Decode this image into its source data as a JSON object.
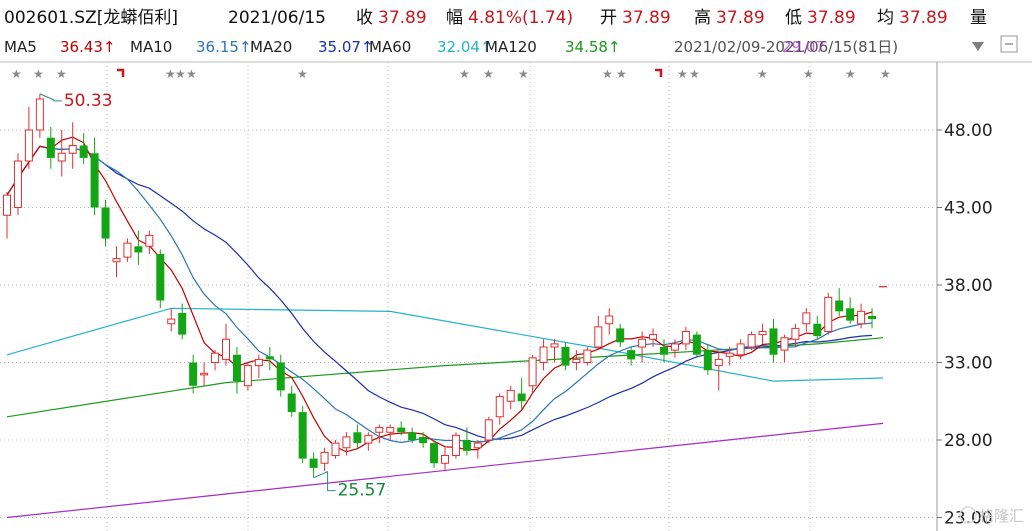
{
  "header": {
    "code_name": "002601.SZ[龙蟒佰利]",
    "date": "2021/06/15",
    "items": [
      {
        "label": "收",
        "value": "37.89"
      },
      {
        "label": "幅",
        "value": "4.81%(1.74)"
      },
      {
        "label": "开",
        "value": "37.89"
      },
      {
        "label": "高",
        "value": "37.89"
      },
      {
        "label": "低",
        "value": "37.89"
      },
      {
        "label": "均",
        "value": "37.89"
      },
      {
        "label": "量",
        "value": ""
      }
    ]
  },
  "ma_bar": {
    "items": [
      {
        "label": "MA5",
        "value": "36.43↑",
        "color": "#c00000"
      },
      {
        "label": "MA10",
        "value": "36.15↑",
        "color": "#2c74b8"
      },
      {
        "label": "MA20",
        "value": "35.07↑",
        "color": "#1b2fa8"
      },
      {
        "label": "MA60",
        "value": "32.04↑",
        "color": "#22b5c9"
      },
      {
        "label": "MA120",
        "value": "34.58↑",
        "color": "#1c9a1c"
      }
    ],
    "overlap_text": "2021/02/09-2021/06/15(81日)",
    "ma250_value": "29.07"
  },
  "watermark": "格隆汇",
  "colors": {
    "up": "#e03131",
    "down": "#13a513",
    "text_up": "#c8161d",
    "text_down": "#138a3a",
    "ma5": "#c00000",
    "ma10": "#2c74b8",
    "ma20": "#1b2fa8",
    "ma60": "#22b5c9",
    "ma120": "#1c9a1c",
    "ma250": "#a42cc8",
    "grid": "#bdbdbd"
  },
  "chart_data": {
    "type": "candlestick",
    "period": "2021/02/09-2021/06/15",
    "bars_count": 81,
    "ylim": [
      23,
      53
    ],
    "yticks": [
      "48.00",
      "43.00",
      "38.00",
      "33.00",
      "28.00",
      "23.00"
    ],
    "ytick_values": [
      48,
      43,
      38,
      33,
      28,
      23
    ],
    "ohlc": [
      [
        42.5,
        44.0,
        41.0,
        43.8
      ],
      [
        43.0,
        46.5,
        42.5,
        46.0
      ],
      [
        46.0,
        49.5,
        45.5,
        48.0
      ],
      [
        48.0,
        50.33,
        47.5,
        50.0
      ],
      [
        47.5,
        48.2,
        45.5,
        46.2
      ],
      [
        46.0,
        48.0,
        45.0,
        46.5
      ],
      [
        46.5,
        48.5,
        45.5,
        47.0
      ],
      [
        47.0,
        47.8,
        45.8,
        46.2
      ],
      [
        46.5,
        47.5,
        42.5,
        43.0
      ],
      [
        43.0,
        43.5,
        40.5,
        41.0
      ],
      [
        39.5,
        40.5,
        38.5,
        39.7
      ],
      [
        39.8,
        41.0,
        39.5,
        40.7
      ],
      [
        40.5,
        41.5,
        39.3,
        40.1
      ],
      [
        40.5,
        41.5,
        40.0,
        41.2
      ],
      [
        40.0,
        40.3,
        36.5,
        37.0
      ],
      [
        35.5,
        36.5,
        35.0,
        35.8
      ],
      [
        36.2,
        36.8,
        34.5,
        34.8
      ],
      [
        33.0,
        33.5,
        31.0,
        31.5
      ],
      [
        32.2,
        33.0,
        31.5,
        32.3
      ],
      [
        33.0,
        33.8,
        32.5,
        33.6
      ],
      [
        33.2,
        35.5,
        32.8,
        34.5
      ],
      [
        33.5,
        34.0,
        31.0,
        31.8
      ],
      [
        31.5,
        33.0,
        31.2,
        32.8
      ],
      [
        32.8,
        33.5,
        32.0,
        33.2
      ],
      [
        33.4,
        34.0,
        32.5,
        33.2
      ],
      [
        33.0,
        33.5,
        30.8,
        31.2
      ],
      [
        31.0,
        31.5,
        29.5,
        29.8
      ],
      [
        29.8,
        30.2,
        26.5,
        26.8
      ],
      [
        26.8,
        27.2,
        25.57,
        26.2
      ],
      [
        26.5,
        27.5,
        26.0,
        27.2
      ],
      [
        27.0,
        28.0,
        26.8,
        27.8
      ],
      [
        27.5,
        28.5,
        27.0,
        28.2
      ],
      [
        28.5,
        29.0,
        27.5,
        27.8
      ],
      [
        27.8,
        28.5,
        27.3,
        28.3
      ],
      [
        28.5,
        29.0,
        27.8,
        28.8
      ],
      [
        28.5,
        29.0,
        28.0,
        28.8
      ],
      [
        28.8,
        29.2,
        28.3,
        28.5
      ],
      [
        28.5,
        28.8,
        27.8,
        28.0
      ],
      [
        28.2,
        28.5,
        27.5,
        27.8
      ],
      [
        27.8,
        28.0,
        26.2,
        26.5
      ],
      [
        26.5,
        27.5,
        26.0,
        27.0
      ],
      [
        27.0,
        28.5,
        26.8,
        28.3
      ],
      [
        28.0,
        28.8,
        27.0,
        27.3
      ],
      [
        27.5,
        28.0,
        26.8,
        27.8
      ],
      [
        28.0,
        29.5,
        27.8,
        29.3
      ],
      [
        29.5,
        31.0,
        29.0,
        30.8
      ],
      [
        30.5,
        31.5,
        30.0,
        31.2
      ],
      [
        31.0,
        32.0,
        30.0,
        30.5
      ],
      [
        31.5,
        33.5,
        31.0,
        33.3
      ],
      [
        33.0,
        34.5,
        32.5,
        34.0
      ],
      [
        34.0,
        34.5,
        33.0,
        34.2
      ],
      [
        34.0,
        34.3,
        32.5,
        32.8
      ],
      [
        33.0,
        33.8,
        32.5,
        33.2
      ],
      [
        33.0,
        34.0,
        32.8,
        33.8
      ],
      [
        34.0,
        36.0,
        33.8,
        35.3
      ],
      [
        35.5,
        36.5,
        34.8,
        36.0
      ],
      [
        35.2,
        35.5,
        34.0,
        34.3
      ],
      [
        33.8,
        34.0,
        32.8,
        33.2
      ],
      [
        34.0,
        35.0,
        33.0,
        34.5
      ],
      [
        34.5,
        35.2,
        34.0,
        34.8
      ],
      [
        34.0,
        34.5,
        33.0,
        33.5
      ],
      [
        33.8,
        34.5,
        33.3,
        34.2
      ],
      [
        34.2,
        35.3,
        33.8,
        35.0
      ],
      [
        34.8,
        35.0,
        33.3,
        33.5
      ],
      [
        33.8,
        34.2,
        32.2,
        32.5
      ],
      [
        32.8,
        33.6,
        31.2,
        33.2
      ],
      [
        33.4,
        34.0,
        32.8,
        33.6
      ],
      [
        33.5,
        34.5,
        33.2,
        34.2
      ],
      [
        34.0,
        35.0,
        33.8,
        34.8
      ],
      [
        34.8,
        35.5,
        34.2,
        35.0
      ],
      [
        35.2,
        35.8,
        33.0,
        33.5
      ],
      [
        33.8,
        34.8,
        33.0,
        34.6
      ],
      [
        34.5,
        35.5,
        34.0,
        35.2
      ],
      [
        35.5,
        36.5,
        35.0,
        36.2
      ],
      [
        35.5,
        36.0,
        34.5,
        34.7
      ],
      [
        35.0,
        37.5,
        34.8,
        37.2
      ],
      [
        37.0,
        37.8,
        36.0,
        36.3
      ],
      [
        36.5,
        37.2,
        35.5,
        35.7
      ],
      [
        35.5,
        36.8,
        35.2,
        36.3
      ],
      [
        36.0,
        36.5,
        35.2,
        35.8
      ],
      [
        37.89,
        37.89,
        37.89,
        37.89
      ]
    ],
    "moving_averages": [
      {
        "name": "MA60",
        "x": [
          0,
          15,
          35,
          55,
          70,
          80
        ],
        "values": [
          33.5,
          36.5,
          36.3,
          33.8,
          31.8,
          32.0
        ]
      },
      {
        "name": "MA120",
        "x": [
          0,
          20,
          40,
          60,
          74,
          80
        ],
        "values": [
          29.5,
          31.7,
          32.8,
          33.6,
          34.2,
          34.6
        ]
      },
      {
        "name": "MA250",
        "x": [
          0,
          80
        ],
        "values": [
          23.0,
          29.07
        ]
      }
    ],
    "annotations": [
      {
        "label": "50.33",
        "bar_index": 3,
        "price": 50.33,
        "kind": "high"
      },
      {
        "label": "25.57",
        "bar_index": 28,
        "price": 25.57,
        "kind": "low"
      }
    ]
  }
}
